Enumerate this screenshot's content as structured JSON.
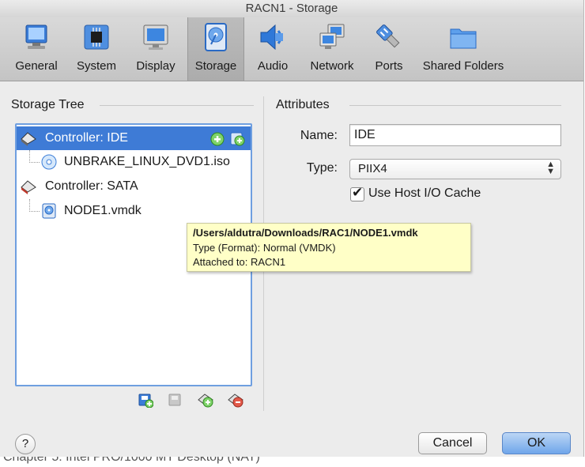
{
  "window": {
    "title": "RACN1 - Storage"
  },
  "toolbar": {
    "items": [
      {
        "label": "General",
        "icon": "monitor-general-icon"
      },
      {
        "label": "System",
        "icon": "chip-icon"
      },
      {
        "label": "Display",
        "icon": "display-icon"
      },
      {
        "label": "Storage",
        "icon": "disk-icon",
        "selected": true
      },
      {
        "label": "Audio",
        "icon": "speaker-icon"
      },
      {
        "label": "Network",
        "icon": "network-icon"
      },
      {
        "label": "Ports",
        "icon": "ports-icon"
      },
      {
        "label": "Shared Folders",
        "icon": "folder-icon"
      }
    ]
  },
  "storage_tree": {
    "title": "Storage Tree",
    "rows": [
      {
        "label": "Controller: IDE",
        "icon": "ide-controller-icon",
        "selected": true
      },
      {
        "label": "UNBRAKE_LINUX_DVD1.iso",
        "icon": "optical-disc-icon"
      },
      {
        "label": "Controller: SATA",
        "icon": "sata-controller-icon"
      },
      {
        "label": "NODE1.vmdk",
        "icon": "hard-disk-icon"
      }
    ],
    "actions": [
      "add-controller-icon",
      "remove-controller-icon",
      "add-attachment-icon",
      "remove-attachment-icon"
    ]
  },
  "tooltip": {
    "path": "/Users/aldutra/Downloads/RAC1/NODE1.vmdk",
    "type_line": "Type (Format):  Normal (VMDK)",
    "attached_line": "Attached to: RACN1"
  },
  "attributes": {
    "title": "Attributes",
    "name_label": "Name:",
    "name_value": "IDE",
    "type_label": "Type:",
    "type_value": "PIIX4",
    "cache_label": "Use Host I/O Cache",
    "cache_checked": true
  },
  "buttons": {
    "help": "?",
    "cancel": "Cancel",
    "ok": "OK"
  },
  "background_text": "Chapter 5:  Intel PRO/1000 MT Desktop (NAT)"
}
